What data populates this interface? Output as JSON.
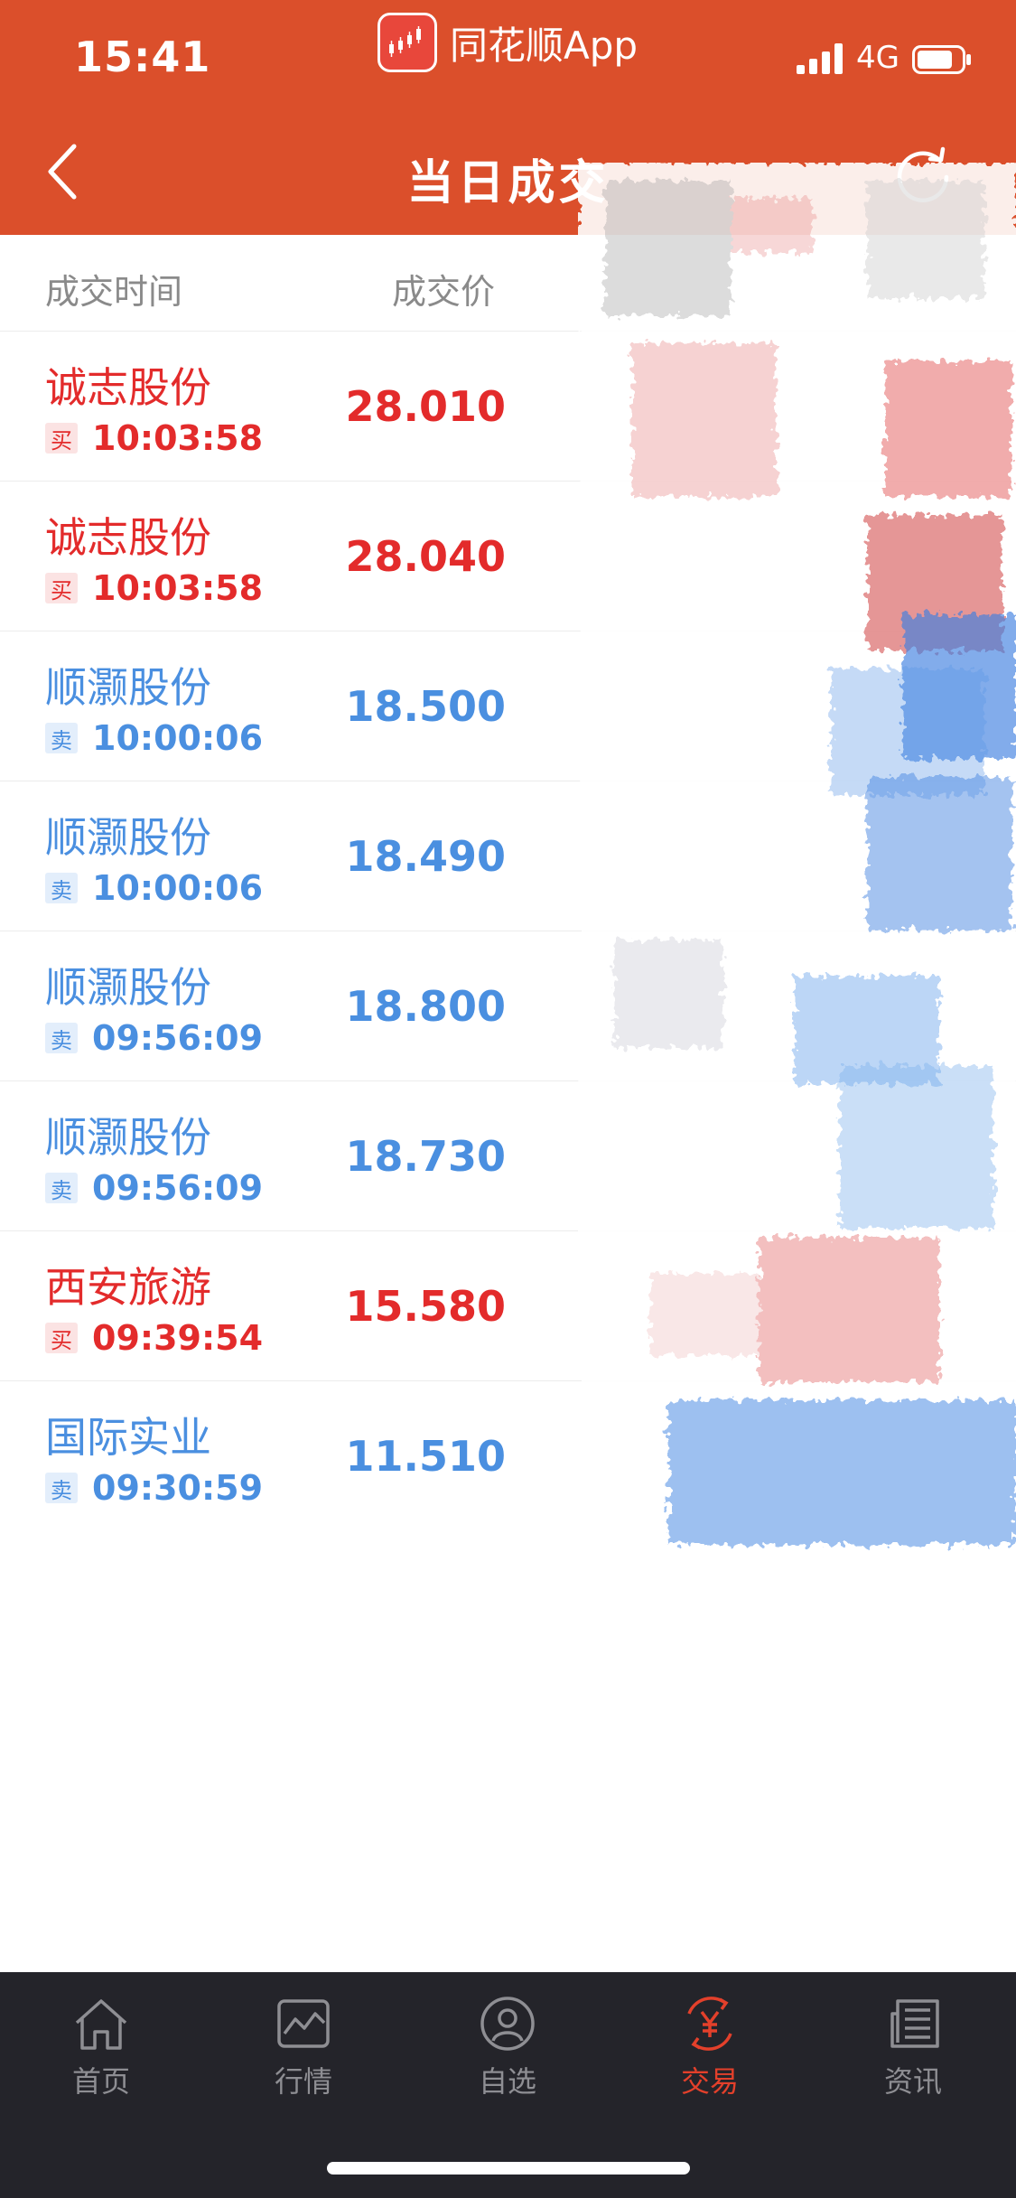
{
  "status_bar": {
    "time": "15:41",
    "app_name": "同花顺App",
    "network": "4G"
  },
  "header": {
    "title": "当日成交"
  },
  "columns": {
    "time": "成交时间",
    "price": "成交价"
  },
  "trades": [
    {
      "name": "诚志股份",
      "side": "买",
      "time": "10:03:58",
      "price": "28.010",
      "type": "buy"
    },
    {
      "name": "诚志股份",
      "side": "买",
      "time": "10:03:58",
      "price": "28.040",
      "type": "buy"
    },
    {
      "name": "顺灏股份",
      "side": "卖",
      "time": "10:00:06",
      "price": "18.500",
      "type": "sell"
    },
    {
      "name": "顺灏股份",
      "side": "卖",
      "time": "10:00:06",
      "price": "18.490",
      "type": "sell"
    },
    {
      "name": "顺灏股份",
      "side": "卖",
      "time": "09:56:09",
      "price": "18.800",
      "type": "sell"
    },
    {
      "name": "顺灏股份",
      "side": "卖",
      "time": "09:56:09",
      "price": "18.730",
      "type": "sell"
    },
    {
      "name": "西安旅游",
      "side": "买",
      "time": "09:39:54",
      "price": "15.580",
      "type": "buy"
    },
    {
      "name": "国际实业",
      "side": "卖",
      "time": "09:30:59",
      "price": "11.510",
      "type": "sell"
    }
  ],
  "tabbar": {
    "home": "首页",
    "market": "行情",
    "watchlist": "自选",
    "trade": "交易",
    "news": "资讯"
  },
  "colors": {
    "header_bg": "#db4f2b",
    "buy": "#e32b2b",
    "sell": "#4a8fe0",
    "tab_active": "#e3402b",
    "tabbar_bg": "#24242a"
  }
}
